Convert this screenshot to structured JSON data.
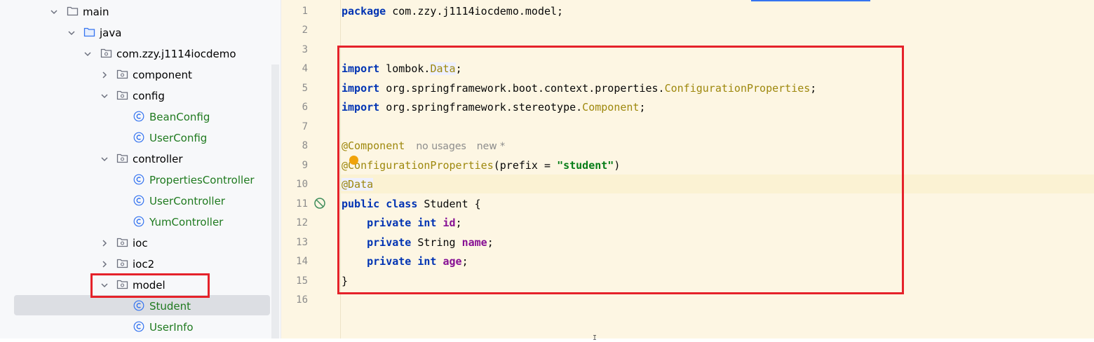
{
  "project_tree": {
    "items": [
      {
        "label": "main",
        "type": "folder",
        "expanded": true
      },
      {
        "label": "java",
        "type": "source-folder",
        "expanded": true
      },
      {
        "label": "com.zzy.j1114iocdemo",
        "type": "package",
        "expanded": true
      },
      {
        "label": "component",
        "type": "package",
        "expanded": false
      },
      {
        "label": "config",
        "type": "package",
        "expanded": true
      },
      {
        "label": "BeanConfig",
        "type": "class"
      },
      {
        "label": "UserConfig",
        "type": "class"
      },
      {
        "label": "controller",
        "type": "package",
        "expanded": true
      },
      {
        "label": "PropertiesController",
        "type": "class"
      },
      {
        "label": "UserController",
        "type": "class"
      },
      {
        "label": "YumController",
        "type": "class"
      },
      {
        "label": "ioc",
        "type": "package",
        "expanded": false
      },
      {
        "label": "ioc2",
        "type": "package",
        "expanded": false
      },
      {
        "label": "model",
        "type": "package",
        "expanded": true
      },
      {
        "label": "Student",
        "type": "class",
        "selected": true
      },
      {
        "label": "UserInfo",
        "type": "class"
      }
    ]
  },
  "editor": {
    "line_numbers": [
      "1",
      "2",
      "3",
      "4",
      "5",
      "6",
      "7",
      "8",
      "9",
      "10",
      "11",
      "12",
      "13",
      "14",
      "15",
      "16"
    ],
    "line1": {
      "kw": "package",
      "rest": " com.zzy.j1114iocdemo.model;"
    },
    "line4": {
      "kw": "import",
      "pkg": " lombok.",
      "cls": "Data",
      "end": ";"
    },
    "line5": {
      "kw": "import",
      "pkg": " org.springframework.boot.context.properties.",
      "cls": "ConfigurationProperties",
      "end": ";"
    },
    "line6": {
      "kw": "import",
      "pkg": " org.springframework.stereotype.",
      "cls": "Component",
      "end": ";"
    },
    "line8": {
      "ann": "@Component",
      "hint1": "no usages",
      "hint2": "new *"
    },
    "line9": {
      "ann": "@ConfigurationProperties",
      "open": "(prefix = ",
      "str": "\"student\"",
      "close": ")"
    },
    "line10": {
      "ann": "@Data"
    },
    "line11": {
      "kw1": "public",
      "kw2": "class",
      "rest": " Student {"
    },
    "line12": {
      "kw1": "private",
      "kw2": "int",
      "field": "id",
      "end": ";"
    },
    "line13": {
      "kw1": "private",
      "type": " String ",
      "field": "name",
      "end": ";"
    },
    "line14": {
      "kw1": "private",
      "kw2": "int",
      "field": "age",
      "end": ";"
    },
    "line15": {
      "text": "}"
    }
  },
  "colors": {
    "highlight_box": "#e5222a",
    "keyword": "#0033b3",
    "annotation": "#9e880d",
    "string": "#067d17",
    "field": "#871094",
    "class_label": "#1f7a1f"
  }
}
